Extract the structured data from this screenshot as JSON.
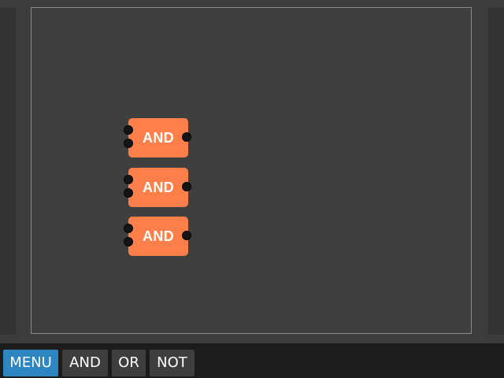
{
  "canvas": {
    "gates": [
      {
        "label": "AND"
      },
      {
        "label": "AND"
      },
      {
        "label": "AND"
      }
    ]
  },
  "toolbar": {
    "menu_label": "MENU",
    "and_label": "AND",
    "or_label": "OR",
    "not_label": "NOT"
  },
  "colors": {
    "gate": "#ff7f4a",
    "menu_accent": "#2e86c1",
    "background": "#3c3c3c",
    "toolbar": "#1c1c1c"
  }
}
